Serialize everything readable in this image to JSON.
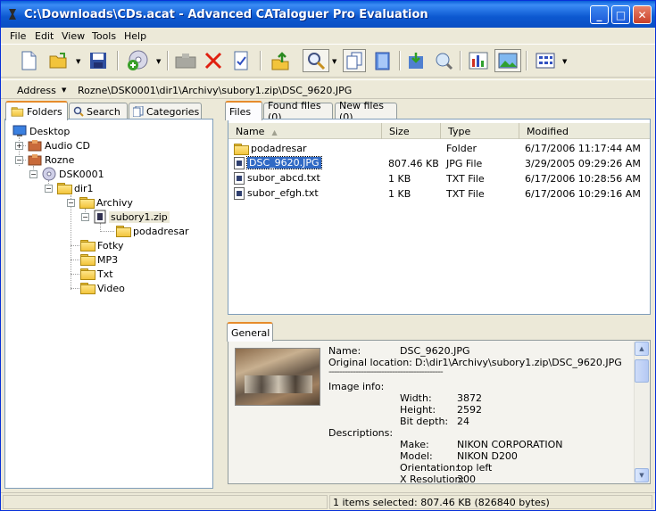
{
  "window": {
    "title": "C:\\Downloads\\CDs.acat - Advanced CATaloguer Pro Evaluation",
    "minimize": "_",
    "maximize": "□",
    "close": "✕"
  },
  "menu": [
    "File",
    "Edit",
    "View",
    "Tools",
    "Help"
  ],
  "address": {
    "label": "Address",
    "path": "Rozne\\DSK0001\\dir1\\Archivy\\subory1.zip\\DSC_9620.JPG"
  },
  "left_tabs": [
    "Folders",
    "Search",
    "Categories"
  ],
  "tree": {
    "desktop": "Desktop",
    "audio": "Audio CD",
    "rozne": "Rozne",
    "dsk": "DSK0001",
    "dir1": "dir1",
    "archivy": "Archivy",
    "zip": "subory1.zip",
    "podadresar": "podadresar",
    "fotky": "Fotky",
    "mp3": "MP3",
    "txt": "Txt",
    "video": "Video"
  },
  "right_tabs": [
    "Files",
    "Found files (0)",
    "New files (0)"
  ],
  "columns": [
    "Name",
    "Size",
    "Type",
    "Modified"
  ],
  "files": [
    {
      "name": "podadresar",
      "size": "",
      "type": "Folder",
      "modified": "6/17/2006 11:17:44 AM"
    },
    {
      "name": "DSC_9620.JPG",
      "size": "807.46 KB",
      "type": "JPG File",
      "modified": "3/29/2005 09:29:26 AM"
    },
    {
      "name": "subor_abcd.txt",
      "size": "1 KB",
      "type": "TXT File",
      "modified": "6/17/2006 10:28:56 AM"
    },
    {
      "name": "subor_efgh.txt",
      "size": "1 KB",
      "type": "TXT File",
      "modified": "6/17/2006 10:29:16 AM"
    }
  ],
  "general": {
    "tab": "General",
    "name_label": "Name:",
    "name_value": "DSC_9620.JPG",
    "loc_label": "Original location:",
    "loc_value": "D:\\dir1\\Archivy\\subory1.zip\\DSC_9620.JPG",
    "dashes": "-------------------------------------------",
    "imageinfo": "Image info:",
    "width_label": "Width:",
    "width_value": "3872",
    "height_label": "Height:",
    "height_value": "2592",
    "depth_label": "Bit depth:",
    "depth_value": "24",
    "descriptions": "Descriptions:",
    "make_label": "Make:",
    "make_value": "NIKON CORPORATION",
    "model_label": "Model:",
    "model_value": "NIKON D200",
    "orient_label": "Orientation:",
    "orient_value": "top left",
    "xres_label": "X Resolution:",
    "xres_value": "300"
  },
  "status": {
    "text": "1 items selected: 807.46 KB (826840 bytes)"
  }
}
